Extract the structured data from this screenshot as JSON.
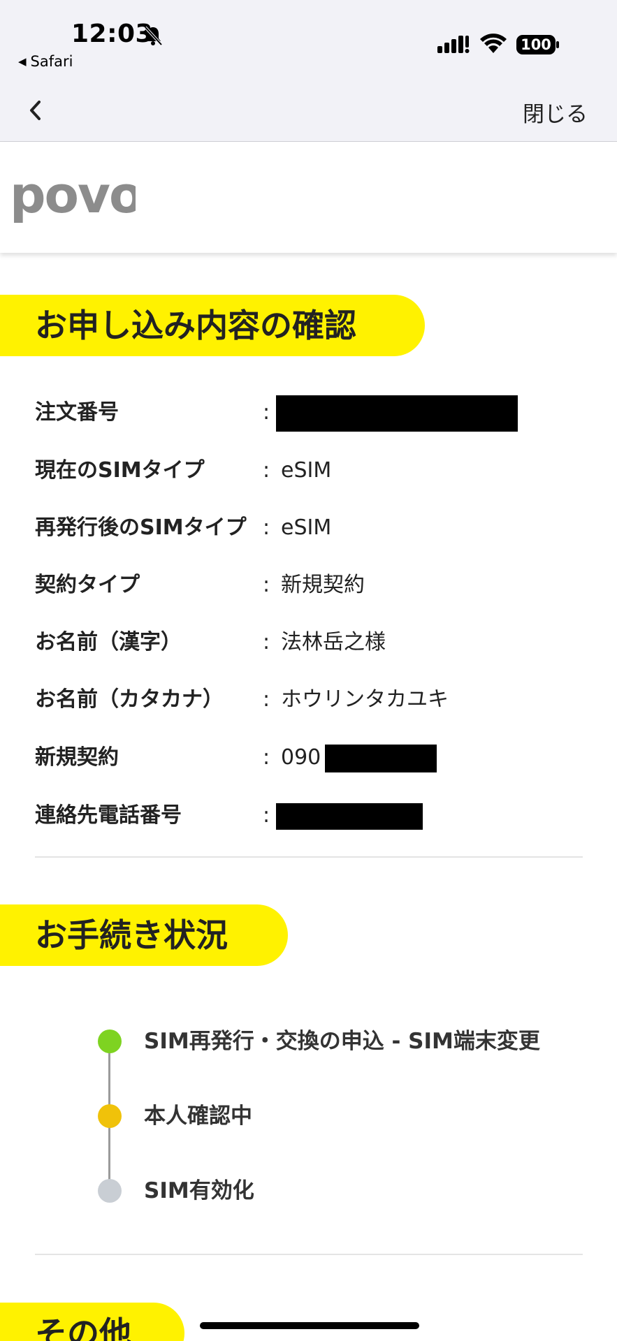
{
  "status_bar": {
    "time": "12:03",
    "back_app": "Safari",
    "battery": "100"
  },
  "nav": {
    "close_label": "閉じる"
  },
  "brand": {
    "logo_text": "povo"
  },
  "confirm_section": {
    "title": "お申し込み内容の確認",
    "rows": [
      {
        "label": "注文番号",
        "value": ""
      },
      {
        "label": "現在のSIMタイプ",
        "value": "eSIM"
      },
      {
        "label": "再発行後のSIMタイプ",
        "value": "eSIM"
      },
      {
        "label": "契約タイプ",
        "value": "新規契約"
      },
      {
        "label": "お名前（漢字）",
        "value": "法林岳之様"
      },
      {
        "label": "お名前（カタカナ）",
        "value": "ホウリンタカユキ"
      },
      {
        "label": "新規契約",
        "value": "090"
      },
      {
        "label": "連絡先電話番号",
        "value": ""
      }
    ],
    "colon": ":"
  },
  "status_section": {
    "title": "お手続き状況",
    "steps": [
      {
        "label": "SIM再発行・交換の申込 - SIM端末変更",
        "state": "done",
        "color": "#7ed321"
      },
      {
        "label": "本人確認中",
        "state": "current",
        "color": "#f0c20a"
      },
      {
        "label": "SIM有効化",
        "state": "pending",
        "color": "#c9ced4"
      }
    ]
  },
  "other_section": {
    "title": "その他"
  },
  "colors": {
    "accent_yellow": "#fff200",
    "status_bar_bg": "#f2f2f7"
  }
}
